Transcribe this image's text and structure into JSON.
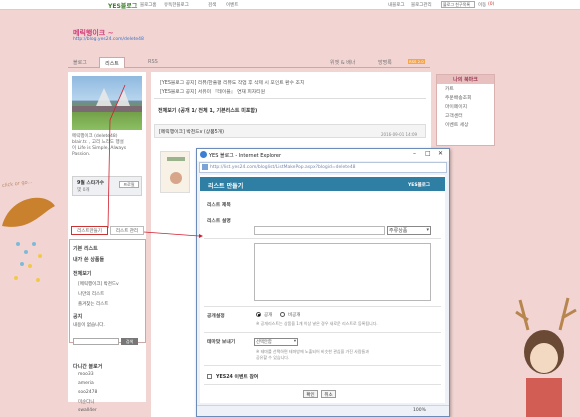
{
  "topbar": {
    "logo": "YES블로그",
    "links": [
      "블로그홈",
      "유독한블로그",
      "검색",
      "이벤트"
    ],
    "my_blog": "내블로그",
    "mgmt": "블로그관리",
    "select": "블로그 친구목록",
    "go": "이동",
    "gosu": "(0)"
  },
  "blog": {
    "title": "메릭행이크 ~",
    "url": "http://blog.yes24.com/delete48"
  },
  "tabs": {
    "blog": "블로그",
    "list": "리스트",
    "rss": "RSS",
    "widget": "위젯 & 배너",
    "guestbook": "방명록",
    "rss_badge": "RSS 2.0"
  },
  "profile": {
    "line1": "메릭행이크 (delete48)",
    "line2": "blair.tr. , 고리 느리도 행설",
    "line3": "이 Life is Simple, Always",
    "line4": "Passion."
  },
  "stats": {
    "title": "9월 스타가수",
    "sub": "몇 0개",
    "extra": "프로필"
  },
  "left_buttons": {
    "make_list": "리스트만들기",
    "manage": "리스트 관리"
  },
  "left_menu": {
    "basic_list": "기본 리스트",
    "my_products": "내가 쓴 상품들",
    "full_view": "전체보기",
    "items": [
      "[메릭행이크] 박천드v",
      "나만의 리스트",
      "즐겨찾는 리스트"
    ]
  },
  "notice": {
    "title": "공지",
    "empty": "내용이 없습니다.",
    "search_btn": "검색"
  },
  "recent": {
    "title": "다니간 블로거",
    "items": [
      "moo33",
      "ameria",
      "soo2478",
      "미순다니",
      "swall4er"
    ]
  },
  "post": {
    "notice1": "[YES블로그 공지] 리뷰/한줄평 리뷰도 작업 후 삭제 시 포인트 환수 조치",
    "notice2": "[YES블로그 공지] 서유미 『테이블』 연재 피자티원",
    "full_view": "전체보기 (공개 1/ 전체 1, 기본리스트 미포함)",
    "entry": "[메릭행이크] 박천드v (상품5개)",
    "date": "2016-09-01 14:09"
  },
  "right_panel": {
    "title": "나의 북마크",
    "items": [
      "카트",
      "주문배송조회",
      "마이페이지",
      "고객센터",
      "이벤트 세상"
    ]
  },
  "ie": {
    "title": "YES 블로그 - Internet Explorer",
    "address": "http://list.yes24.com/bloglist/ListMakePop.aspx?blogid=delete48",
    "header": "리스트 만들기",
    "header_logo": "YES블로그",
    "label_title": "리스트 제목",
    "category": "주류상품",
    "label_desc": "리스트 설명",
    "label_public": "공개설정",
    "opt_public": "공개",
    "opt_private": "비공개",
    "public_note": "※ 공개리스트는 상품을 1개 이상 넣은 경우 새로운 리스트로 등록됩니다.",
    "label_theme": "테마맞 보내기",
    "theme_select": "선택안함",
    "theme_note1": "※ 테마를 선택하면 테마방에 노출되어 비슷한 관심을 가진 사람들과",
    "theme_note2": "공유할 수 있습니다.",
    "event_label": "YES24 이벤트 참여",
    "ok": "확인",
    "cancel": "취소",
    "zoom": "100%"
  },
  "deco": {
    "click": "click or go..."
  },
  "colors": {
    "header": "#2f7fa4",
    "accent": "#d33a78",
    "background": "#f2d5d3"
  }
}
